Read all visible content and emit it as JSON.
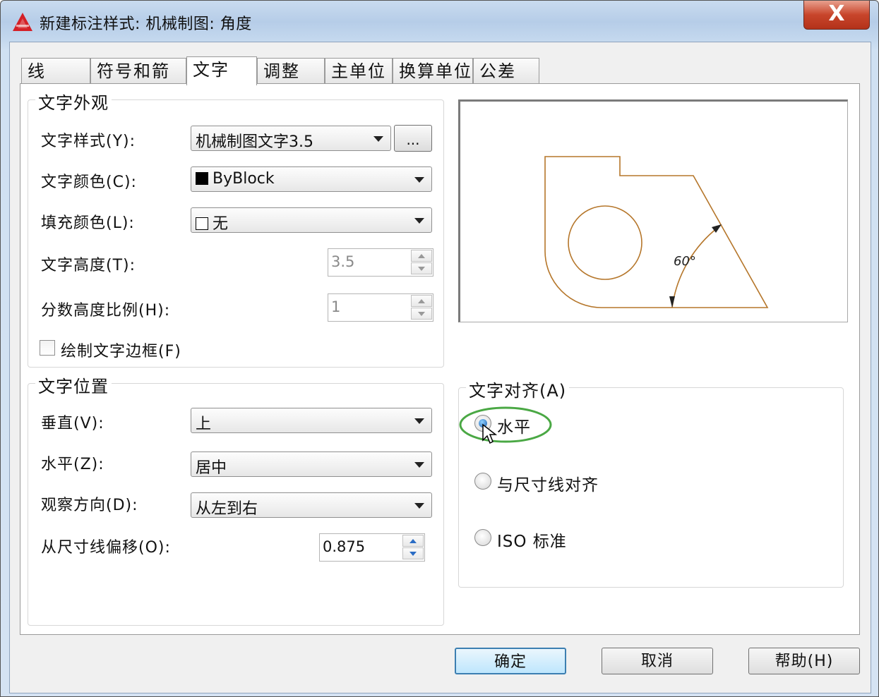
{
  "window": {
    "title": "新建标注样式: 机械制图: 角度",
    "close_label": "X"
  },
  "tabs": [
    {
      "label": "线",
      "active": false
    },
    {
      "label": "符号和箭头",
      "active": false
    },
    {
      "label": "文字",
      "active": true
    },
    {
      "label": "调整",
      "active": false
    },
    {
      "label": "主单位",
      "active": false
    },
    {
      "label": "换算单位",
      "active": false
    },
    {
      "label": "公差",
      "active": false
    }
  ],
  "appearance": {
    "title": "文字外观",
    "text_style_label": "文字样式(Y):",
    "text_style_value": "机械制图文字3.5",
    "text_style_browse": "...",
    "text_color_label": "文字颜色(C):",
    "text_color_value": "ByBlock",
    "text_color_swatch": "#000000",
    "fill_color_label": "填充颜色(L):",
    "fill_color_value": "无",
    "fill_color_swatch": "#ffffff",
    "text_height_label": "文字高度(T):",
    "text_height_value": "3.5",
    "fraction_scale_label": "分数高度比例(H):",
    "fraction_scale_value": "1",
    "frame_label": "绘制文字边框(F)",
    "frame_checked": false
  },
  "position": {
    "title": "文字位置",
    "vertical_label": "垂直(V):",
    "vertical_value": "上",
    "horizontal_label": "水平(Z):",
    "horizontal_value": "居中",
    "direction_label": "观察方向(D):",
    "direction_value": "从左到右",
    "offset_label": "从尺寸线偏移(O):",
    "offset_value": "0.875"
  },
  "preview": {
    "angle_label": "60°",
    "line_color": "#b5762a"
  },
  "alignment": {
    "title": "文字对齐(A)",
    "options": [
      {
        "label": "水平",
        "checked": true
      },
      {
        "label": "与尺寸线对齐",
        "checked": false
      },
      {
        "label": "ISO 标准",
        "checked": false
      }
    ],
    "highlight_color": "#4aa844"
  },
  "buttons": {
    "ok": "确定",
    "cancel": "取消",
    "help": "帮助(H)"
  }
}
